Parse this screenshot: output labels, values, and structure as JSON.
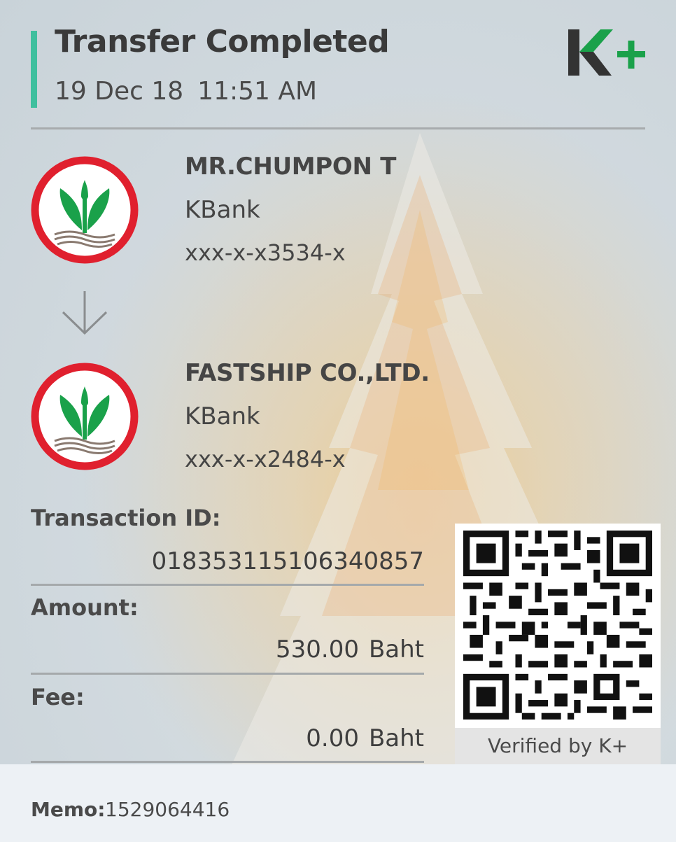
{
  "header": {
    "title": "Transfer Completed",
    "date": "19 Dec 18",
    "time": "11:51 AM",
    "accent_color": "#3fbf9e",
    "logo_icon": "kplus-logo",
    "logo_text": "K+"
  },
  "sender": {
    "name": "MR.CHUMPON T",
    "bank": "KBank",
    "account": "xxx-x-x3534-x",
    "logo_icon": "kbank-logo"
  },
  "direction_icon": "arrow-down-icon",
  "receiver": {
    "name": "FASTSHIP CO.,LTD.",
    "bank": "KBank",
    "account": "xxx-x-x2484-x",
    "logo_icon": "kbank-logo"
  },
  "details": {
    "transaction_id_label": "Transaction ID:",
    "transaction_id": "018353115106340857",
    "amount_label": "Amount:",
    "amount": "530.00",
    "amount_unit": "Baht",
    "fee_label": "Fee:",
    "fee": "0.00",
    "fee_unit": "Baht"
  },
  "qr": {
    "icon": "qr-code",
    "caption": "Verified by K+"
  },
  "memo": {
    "label": "Memo:",
    "value": "1529064416"
  },
  "colors": {
    "kbank_green": "#1aa14a",
    "kbank_red": "#e0202e",
    "kplus_green": "#1aa14a",
    "text": "#3c3c3c"
  }
}
